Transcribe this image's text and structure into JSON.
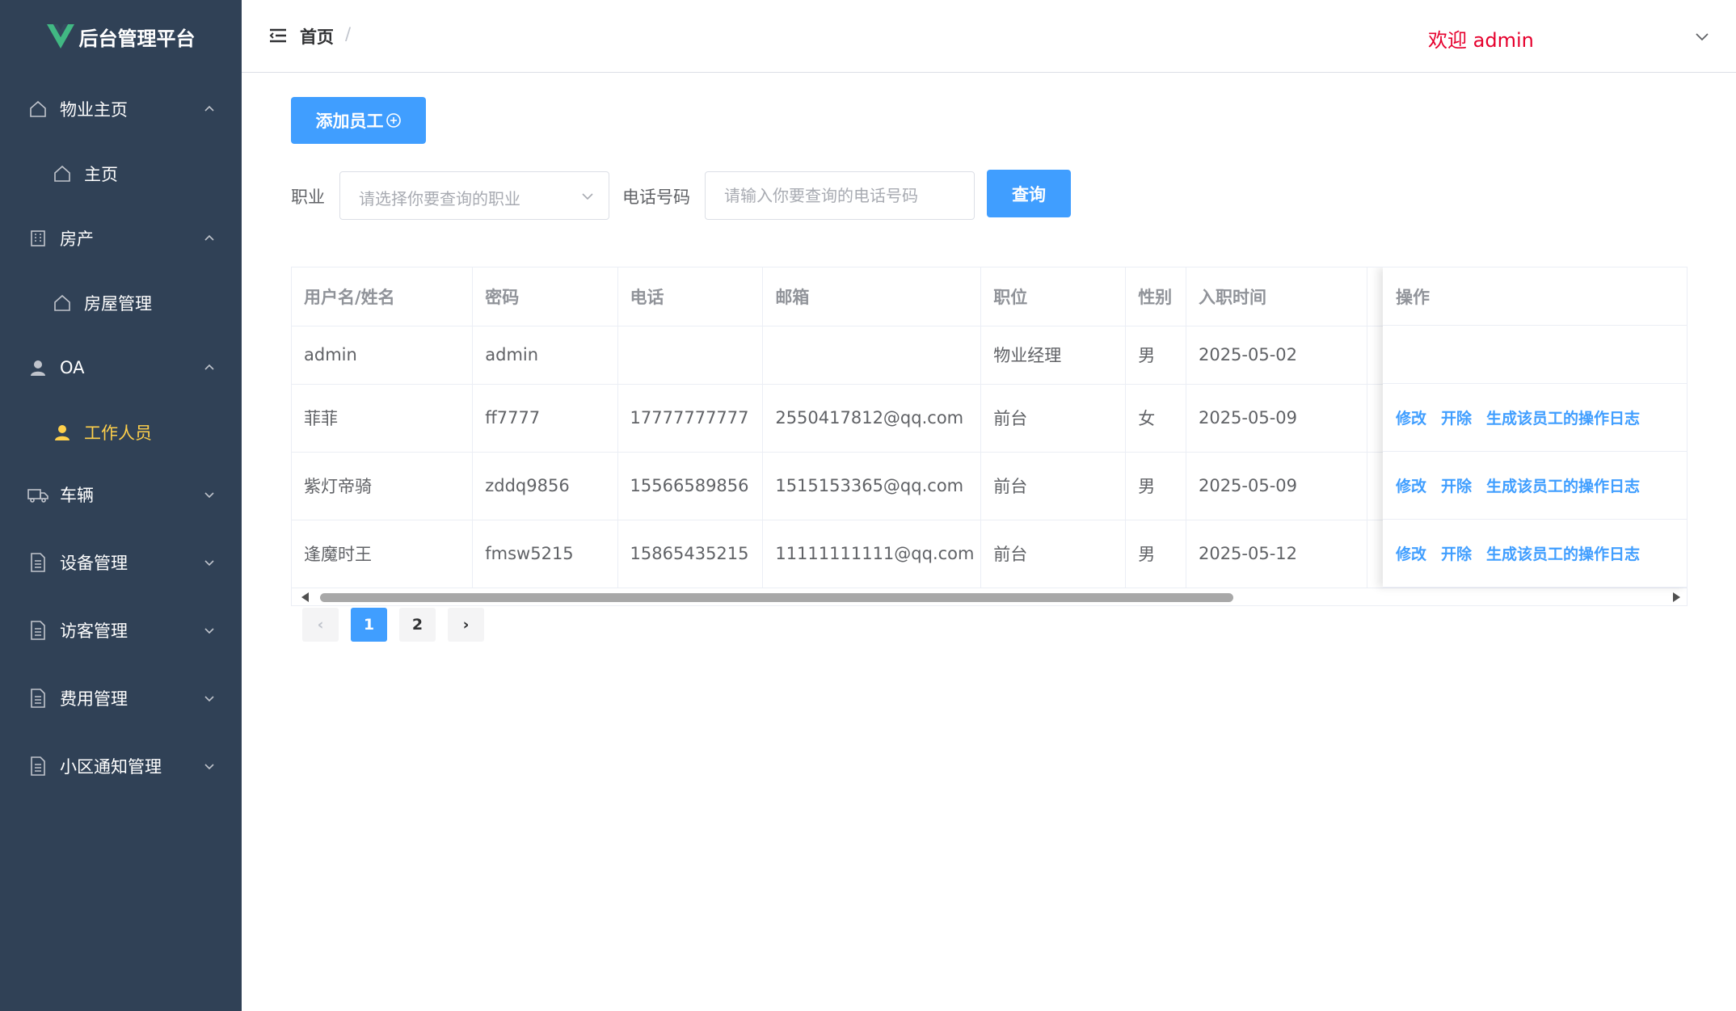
{
  "app": {
    "title": "后台管理平台",
    "logo_color": "#41b883"
  },
  "sidebar": {
    "items": [
      {
        "label": "物业主页",
        "icon": "house-icon",
        "arrow": "up"
      },
      {
        "label": "主页",
        "icon": "house-icon",
        "sub": true
      },
      {
        "label": "房产",
        "icon": "building-icon",
        "arrow": "up"
      },
      {
        "label": "房屋管理",
        "icon": "house-icon",
        "sub": true
      },
      {
        "label": "OA",
        "icon": "user-icon",
        "arrow": "up"
      },
      {
        "label": "工作人员",
        "icon": "user-icon",
        "sub": true,
        "active": true
      },
      {
        "label": "车辆",
        "icon": "truck-icon",
        "arrow": "down"
      },
      {
        "label": "设备管理",
        "icon": "document-icon",
        "arrow": "down"
      },
      {
        "label": "访客管理",
        "icon": "document-icon",
        "arrow": "down"
      },
      {
        "label": "费用管理",
        "icon": "document-icon",
        "arrow": "down"
      },
      {
        "label": "小区通知管理",
        "icon": "document-icon",
        "arrow": "down"
      }
    ]
  },
  "header": {
    "breadcrumb": "首页",
    "separator": "/",
    "welcome": "欢迎 admin"
  },
  "toolbar": {
    "add_label": "添加员工",
    "job_label": "职业",
    "job_placeholder": "请选择你要查询的职业",
    "phone_label": "电话号码",
    "phone_placeholder": "请输入你要查询的电话号码",
    "query_label": "查询"
  },
  "table": {
    "columns": [
      "用户名/姓名",
      "密码",
      "电话",
      "邮箱",
      "职位",
      "性别",
      "入职时间",
      ""
    ],
    "action_header": "操作",
    "rows": [
      {
        "name": "admin",
        "password": "admin",
        "phone": "",
        "email": "",
        "position": "物业经理",
        "gender": "男",
        "date": "2025-05-02",
        "actions": false
      },
      {
        "name": "菲菲",
        "password": "ff7777",
        "phone": "17777777777",
        "email": "2550417812@qq.com",
        "position": "前台",
        "gender": "女",
        "date": "2025-05-09",
        "actions": true
      },
      {
        "name": "紫灯帝骑",
        "password": "zddq9856",
        "phone": "15566589856",
        "email": "1515153365@qq.com",
        "position": "前台",
        "gender": "男",
        "date": "2025-05-09",
        "actions": true
      },
      {
        "name": "逢魔时王",
        "password": "fmsw5215",
        "phone": "15865435215",
        "email": "11111111111@qq.com",
        "position": "前台",
        "gender": "男",
        "date": "2025-05-12",
        "actions": true
      }
    ],
    "actions": {
      "edit": "修改",
      "fire": "开除",
      "log": "生成该员工的操作日志"
    }
  },
  "pagination": {
    "prev": "‹",
    "pages": [
      "1",
      "2"
    ],
    "current": "1",
    "next": "›"
  },
  "colors": {
    "sidebar_bg": "#304156",
    "primary": "#409eff",
    "active_menu": "#ffd04b",
    "welcome": "#e6002d"
  }
}
